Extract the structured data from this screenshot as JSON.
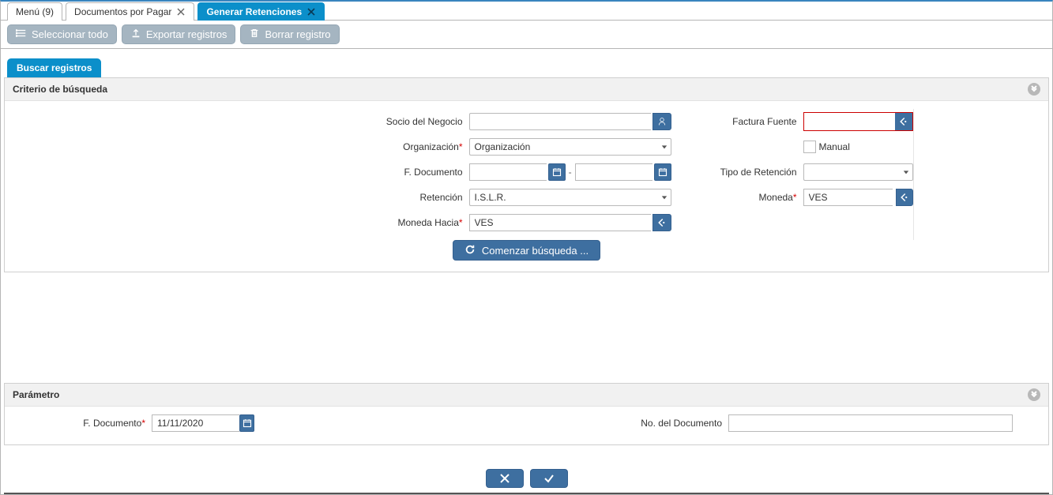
{
  "tabs": [
    {
      "label": "Menú (9)",
      "closable": false
    },
    {
      "label": "Documentos por Pagar",
      "closable": true
    },
    {
      "label": "Generar Retenciones",
      "closable": true,
      "active": true
    }
  ],
  "toolbar": {
    "select_all": "Seleccionar todo",
    "export": "Exportar registros",
    "delete": "Borrar registro"
  },
  "subtab": {
    "search": "Buscar registros"
  },
  "criteria": {
    "title": "Criterio de búsqueda",
    "labels": {
      "socio": "Socio del Negocio",
      "factura": "Factura Fuente",
      "organizacion": "Organización",
      "manual": "Manual",
      "fdoc": "F. Documento",
      "tipo_ret": "Tipo de Retención",
      "retencion": "Retención",
      "moneda": "Moneda",
      "moneda_hacia": "Moneda Hacia"
    },
    "values": {
      "socio": "",
      "factura": "",
      "organizacion": "Organización",
      "fdoc_from": "",
      "fdoc_to": "",
      "tipo_ret": "",
      "retencion": "I.S.L.R.",
      "moneda": "VES",
      "moneda_hacia": "VES"
    },
    "search_btn": "Comenzar búsqueda ..."
  },
  "param": {
    "title": "Parámetro",
    "labels": {
      "fdoc": "F. Documento",
      "nodoc": "No. del Documento"
    },
    "values": {
      "fdoc": "11/11/2020",
      "nodoc": ""
    }
  }
}
